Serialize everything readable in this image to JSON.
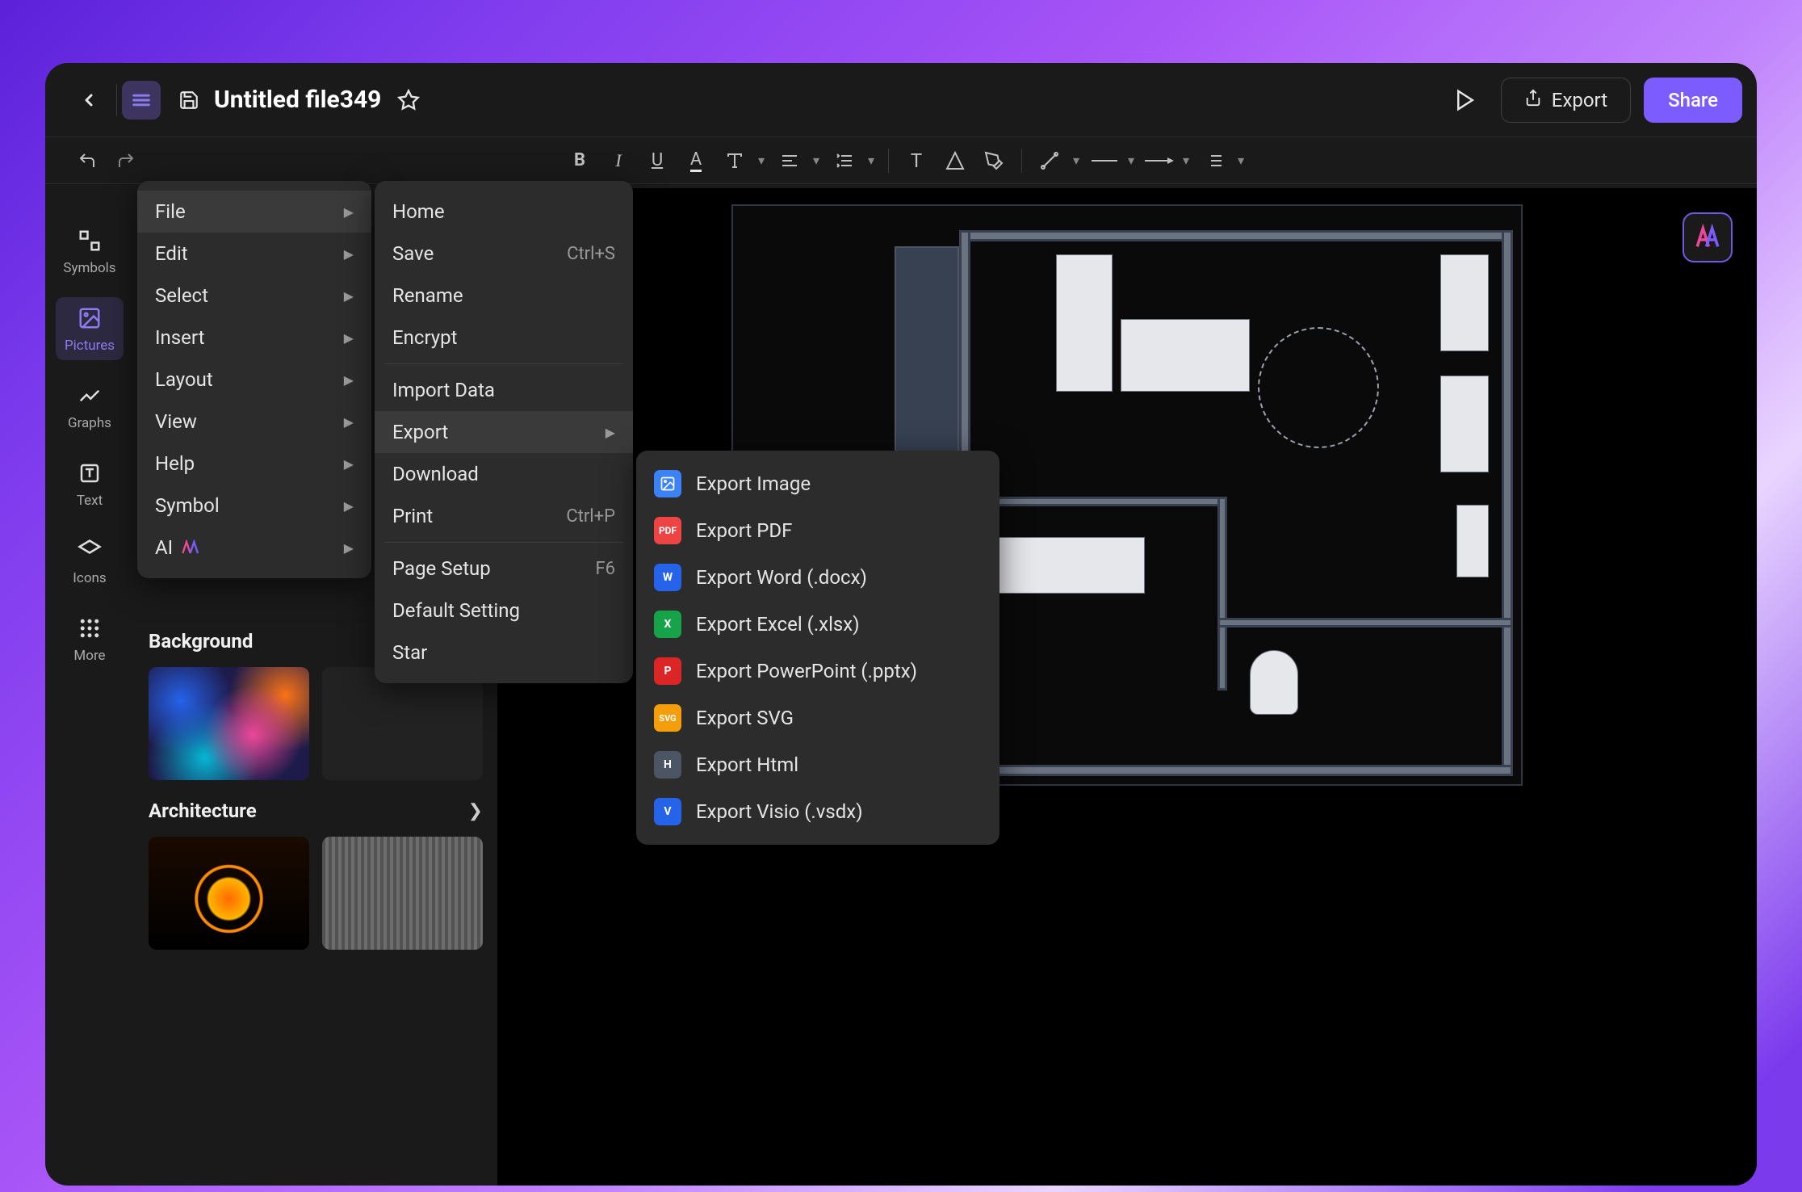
{
  "topbar": {
    "title": "Untitled file349",
    "export_label": "Export",
    "share_label": "Share"
  },
  "rail": {
    "items": [
      {
        "label": "Symbols"
      },
      {
        "label": "Pictures"
      },
      {
        "label": "Graphs"
      },
      {
        "label": "Text"
      },
      {
        "label": "Icons"
      },
      {
        "label": "More"
      }
    ]
  },
  "side_panel": {
    "background_title": "Background",
    "architecture_title": "Architecture"
  },
  "main_menu": {
    "items": [
      {
        "label": "File",
        "submenu": true,
        "hover": true
      },
      {
        "label": "Edit",
        "submenu": true
      },
      {
        "label": "Select",
        "submenu": true
      },
      {
        "label": "Insert",
        "submenu": true
      },
      {
        "label": "Layout",
        "submenu": true
      },
      {
        "label": "View",
        "submenu": true
      },
      {
        "label": "Help",
        "submenu": true
      },
      {
        "label": "Symbol",
        "submenu": true
      },
      {
        "label": "AI",
        "submenu": true,
        "ai": true
      }
    ]
  },
  "file_menu": {
    "home": "Home",
    "save": "Save",
    "save_sc": "Ctrl+S",
    "rename": "Rename",
    "encrypt": "Encrypt",
    "import": "Import Data",
    "export": "Export",
    "download": "Download",
    "print": "Print",
    "print_sc": "Ctrl+P",
    "page_setup": "Page Setup",
    "page_setup_sc": "F6",
    "default_setting": "Default Setting",
    "star": "Star"
  },
  "export_menu": {
    "items": [
      {
        "label": "Export Image",
        "fmt": "img",
        "badge": "▦"
      },
      {
        "label": "Export PDF",
        "fmt": "pdf",
        "badge": "PDF"
      },
      {
        "label": "Export Word (.docx)",
        "fmt": "word",
        "badge": "W"
      },
      {
        "label": "Export Excel (.xlsx)",
        "fmt": "xls",
        "badge": "X"
      },
      {
        "label": "Export PowerPoint (.pptx)",
        "fmt": "ppt",
        "badge": "P"
      },
      {
        "label": "Export SVG",
        "fmt": "svg",
        "badge": "SVG"
      },
      {
        "label": "Export Html",
        "fmt": "html",
        "badge": "H"
      },
      {
        "label": "Export Visio (.vsdx)",
        "fmt": "vsd",
        "badge": "V"
      }
    ]
  }
}
